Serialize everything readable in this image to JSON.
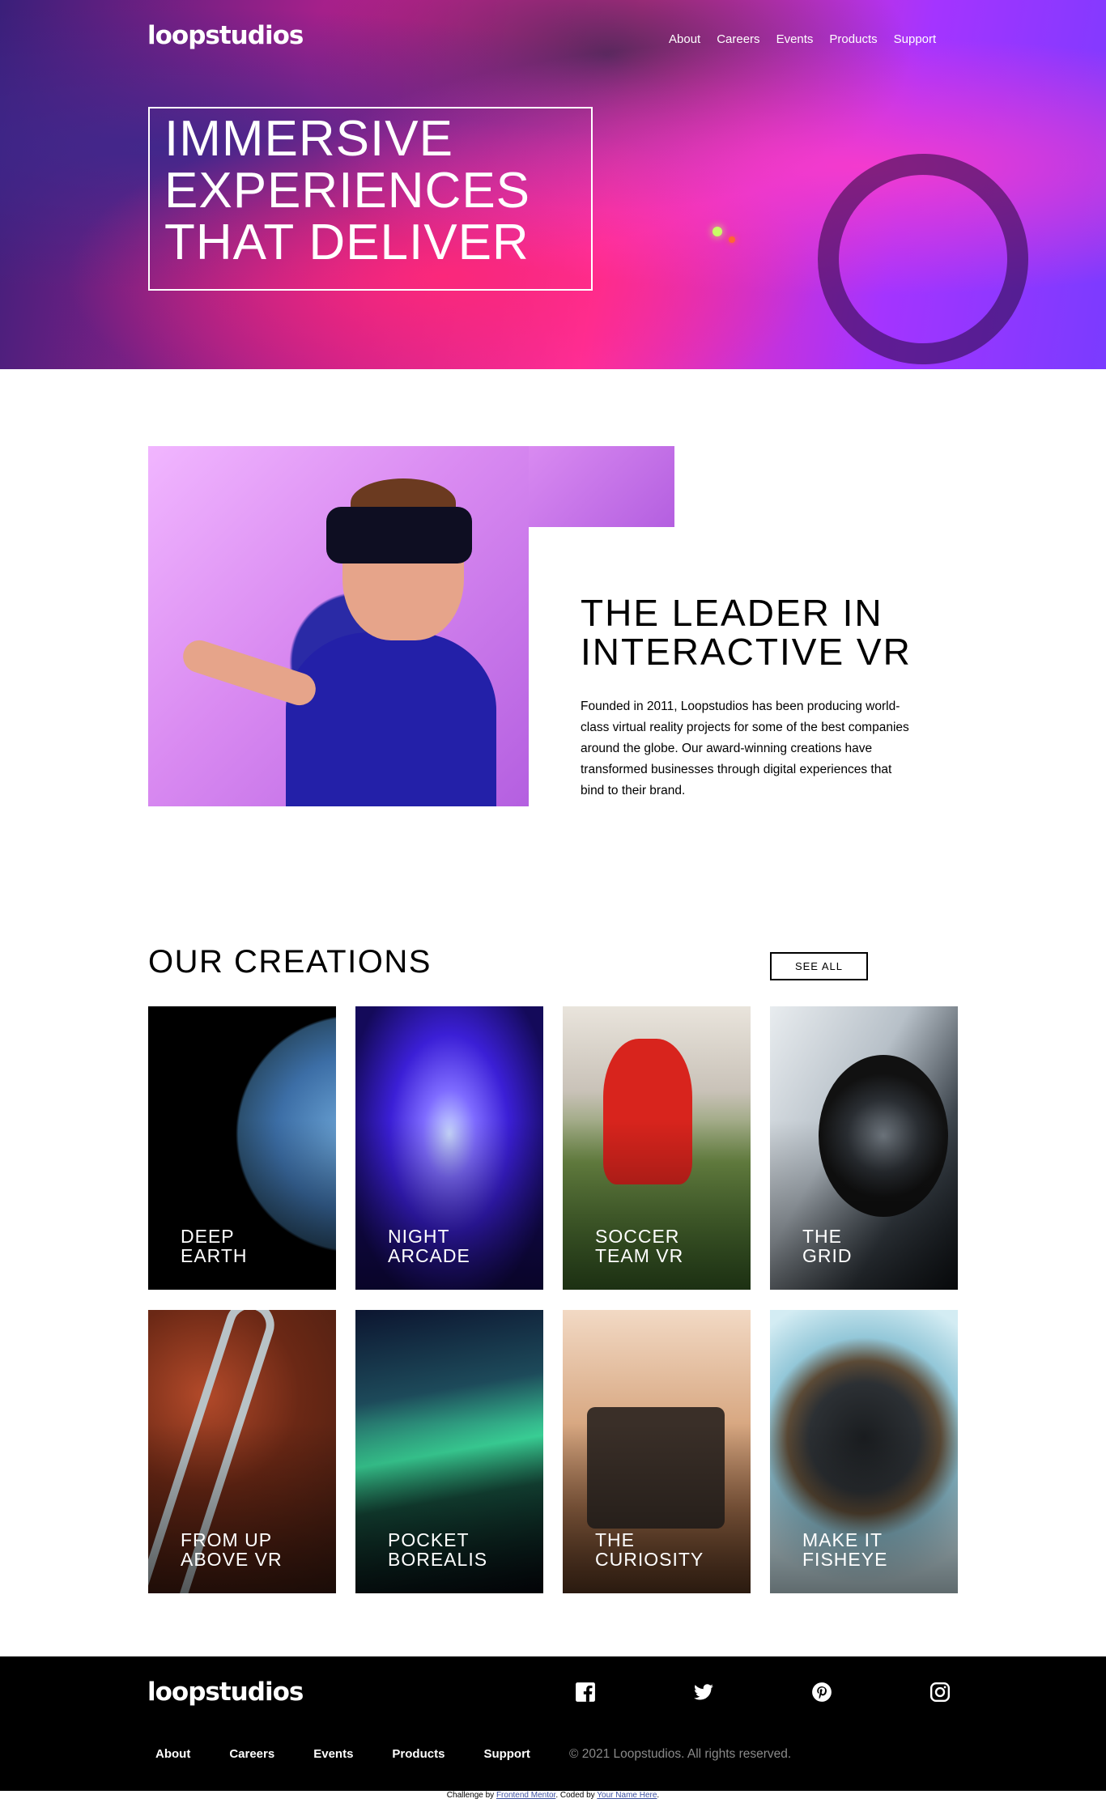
{
  "brand": {
    "logo": "loopstudios"
  },
  "nav": [
    "About",
    "Careers",
    "Events",
    "Products",
    "Support"
  ],
  "hero": {
    "lines": [
      "IMMERSIVE",
      "EXPERIENCES",
      "THAT DELIVER"
    ]
  },
  "about": {
    "title_lines": [
      "THE LEADER IN",
      "INTERACTIVE VR"
    ],
    "text": "Founded in 2011, Loopstudios has been producing world-class virtual reality projects for some of the best companies around the globe. Our award-winning creations have transformed businesses through digital experiences that bind to their brand."
  },
  "creations": {
    "title": "OUR CREATIONS",
    "see_all": "SEE ALL",
    "items": [
      {
        "lines": [
          "DEEP",
          "EARTH"
        ]
      },
      {
        "lines": [
          "NIGHT",
          "ARCADE"
        ]
      },
      {
        "lines": [
          "SOCCER",
          "TEAM VR"
        ]
      },
      {
        "lines": [
          "THE",
          "GRID"
        ]
      },
      {
        "lines": [
          "FROM UP",
          "ABOVE VR"
        ]
      },
      {
        "lines": [
          "POCKET",
          "BOREALIS"
        ]
      },
      {
        "lines": [
          "THE",
          "CURIOSITY"
        ]
      },
      {
        "lines": [
          "MAKE IT",
          "FISHEYE"
        ]
      }
    ]
  },
  "footer": {
    "logo": "loopstudios",
    "social": [
      "facebook-icon",
      "twitter-icon",
      "pinterest-icon",
      "instagram-icon"
    ],
    "nav": [
      "About",
      "Careers",
      "Events",
      "Products",
      "Support"
    ],
    "copyright": "© 2021 Loopstudios. All rights reserved."
  },
  "attribution": {
    "prefix": "Challenge by",
    "link1": "Frontend Mentor",
    "middle": ". Coded by",
    "link2": "Your Name Here",
    "suffix": "."
  }
}
